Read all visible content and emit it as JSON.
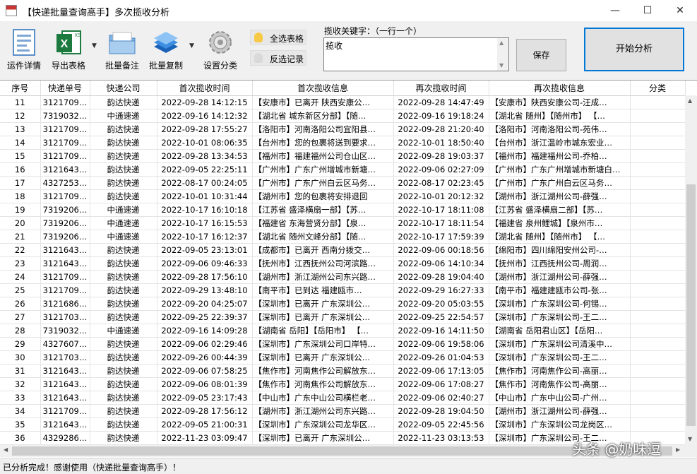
{
  "window": {
    "title": "【快递批量查询高手】多次揽收分析",
    "min": "—",
    "max": "☐",
    "close": "✕"
  },
  "toolbar": {
    "detail": "运件详情",
    "export": "导出表格",
    "export_badge": "XS",
    "remark": "批量备注",
    "copy": "批量复制",
    "category": "设置分类",
    "select_all": "全选表格",
    "invert": "反选记录",
    "keyword_label": "揽收关键字：（一行一个）",
    "keyword_value": "揽收",
    "save": "保存",
    "start": "开始分析"
  },
  "colors": {
    "accent": "#0078d7",
    "excel_green": "#1d7a3e",
    "bulb": "#f7c948"
  },
  "icons": {
    "detail": "document-icon",
    "export": "excel-icon",
    "remark": "folder-icon",
    "copy": "stack-icon",
    "category": "gear-icon",
    "bulb": "bulb-icon"
  },
  "table": {
    "columns": [
      "序号",
      "快递单号",
      "快递公司",
      "首次揽收时间",
      "首次揽收信息",
      "再次揽收时间",
      "再次揽收信息",
      "分类"
    ],
    "rows": [
      [
        "11",
        "3121709…",
        "韵达快递",
        "2022-09-28 14:12:15",
        "【安康市】已离开 陕西安康公…",
        "2022-09-28 14:47:49",
        "【安康市】陕西安康公司-汪成…",
        ""
      ],
      [
        "12",
        "7319032…",
        "中通速递",
        "2022-09-16 14:12:32",
        "【湖北省 城东新区分部】【随…",
        "2022-09-16 19:18:24",
        "【湖北省 随州】【随州市】 【…",
        ""
      ],
      [
        "13",
        "3121709…",
        "韵达快递",
        "2022-09-28 17:55:27",
        "【洛阳市】河南洛阳公司宜阳县…",
        "2022-09-28 21:20:40",
        "【洛阳市】河南洛阳公司-苑伟…",
        ""
      ],
      [
        "14",
        "3121709…",
        "韵达快递",
        "2022-10-01 08:06:35",
        "【台州市】您的包裹将送到要求…",
        "2022-10-01 18:50:40",
        "【台州市】浙江温岭市城东宏业…",
        ""
      ],
      [
        "15",
        "3121709…",
        "韵达快递",
        "2022-09-28 13:34:53",
        "【福州市】福建福州公司仓山区…",
        "2022-09-28 19:03:37",
        "【福州市】福建福州公司-乔柏…",
        ""
      ],
      [
        "16",
        "3121643…",
        "韵达快递",
        "2022-09-05 22:25:11",
        "【广州市】广东广州增城市新塘…",
        "2022-09-06 02:27:09",
        "【广州市】广东广州增城市新塘白…",
        ""
      ],
      [
        "17",
        "4327253…",
        "韵达快递",
        "2022-08-17 00:24:05",
        "【广州市】广东广州白云区马务…",
        "2022-08-17 02:23:45",
        "【广州市】广东广州白云区马务…",
        ""
      ],
      [
        "18",
        "3121709…",
        "韵达快递",
        "2022-10-01 10:31:44",
        "【湖州市】您的包裹将安排退回",
        "2022-10-01 20:12:32",
        "【湖州市】浙江湖州公司-薛强…",
        ""
      ],
      [
        "19",
        "7319206…",
        "中通速递",
        "2022-10-17 16:10:18",
        "【江苏省 盛泽横扇一部】【苏…",
        "2022-10-17 18:11:08",
        "【江苏省 盛泽横扇二部】【苏…",
        ""
      ],
      [
        "20",
        "7319206…",
        "中通速递",
        "2022-10-17 16:15:53",
        "【福建省 东海营贤分部】【泉…",
        "2022-10-17 18:11:54",
        "【福建省 泉州鲤城】【泉州市…",
        ""
      ],
      [
        "21",
        "7319206…",
        "中通速递",
        "2022-10-17 16:12:37",
        "【湖北省 随州文峰分部】【随…",
        "2022-10-17 17:59:39",
        "【湖北省 随州】【随州市】 【…",
        ""
      ],
      [
        "22",
        "3121643…",
        "韵达快递",
        "2022-09-05 23:13:01",
        "【成都市】已离开 西南分拨交…",
        "2022-09-06 00:18:56",
        "【绵阳市】四川绵阳安州公司-…",
        ""
      ],
      [
        "23",
        "3121643…",
        "韵达快递",
        "2022-09-06 09:46:33",
        "【抚州市】江西抚州公司河滨路…",
        "2022-09-06 14:10:34",
        "【抚州市】江西抚州公司-周润…",
        ""
      ],
      [
        "24",
        "3121709…",
        "韵达快递",
        "2022-09-28 17:56:10",
        "【湖州市】浙江湖州公司东兴路…",
        "2022-09-28 19:04:40",
        "【湖州市】浙江湖州公司-薛强…",
        ""
      ],
      [
        "25",
        "3121709…",
        "韵达快递",
        "2022-09-29 13:48:10",
        "【南平市】已到达 福建瓯市…",
        "2022-09-29 16:27:33",
        "【南平市】福建建瓯市公司-张…",
        ""
      ],
      [
        "26",
        "3121686…",
        "韵达快递",
        "2022-09-20 04:25:07",
        "【深圳市】已离开 广东深圳公…",
        "2022-09-20 05:03:55",
        "【深圳市】广东深圳公司-何锡…",
        ""
      ],
      [
        "27",
        "3121703…",
        "韵达快递",
        "2022-09-25 22:39:37",
        "【深圳市】已离开 广东深圳公…",
        "2022-09-25 22:54:57",
        "【深圳市】广东深圳公司-王二…",
        ""
      ],
      [
        "28",
        "7319032…",
        "中通速递",
        "2022-09-16 14:09:28",
        "【湖南省 岳阳】【岳阳市】 【…",
        "2022-09-16 14:11:50",
        "【湖南省 岳阳君山区】【岳阳…",
        ""
      ],
      [
        "29",
        "4327607…",
        "韵达快递",
        "2022-09-06 02:29:46",
        "【深圳市】广东深圳公司口岸特…",
        "2022-09-06 19:58:06",
        "【深圳市】广东深圳公司清溪中…",
        ""
      ],
      [
        "30",
        "3121703…",
        "韵达快递",
        "2022-09-26 00:44:39",
        "【深圳市】已离开 广东深圳公…",
        "2022-09-26 01:04:53",
        "【深圳市】广东深圳公司-王二…",
        ""
      ],
      [
        "31",
        "3121643…",
        "韵达快递",
        "2022-09-06 07:58:25",
        "【焦作市】河南焦作公司解放东…",
        "2022-09-06 17:13:05",
        "【焦作市】河南焦作公司-高丽…",
        ""
      ],
      [
        "32",
        "3121643…",
        "韵达快递",
        "2022-09-06 08:01:39",
        "【焦作市】河南焦作公司解放东…",
        "2022-09-06 17:08:27",
        "【焦作市】河南焦作公司-高丽…",
        ""
      ],
      [
        "33",
        "3121643…",
        "韵达快递",
        "2022-09-05 23:17:43",
        "【中山市】广东中山公司横栏老…",
        "2022-09-06 02:40:27",
        "【中山市】广东中山公司-广州…",
        ""
      ],
      [
        "34",
        "3121709…",
        "韵达快递",
        "2022-09-28 17:56:12",
        "【湖州市】浙江湖州公司东兴路…",
        "2022-09-28 19:04:50",
        "【湖州市】浙江湖州公司-薛强…",
        ""
      ],
      [
        "35",
        "3121643…",
        "韵达快递",
        "2022-09-05 21:00:31",
        "【深圳市】广东深圳公司龙华区…",
        "2022-09-05 22:45:56",
        "【深圳市】广东深圳公司龙岗区…",
        ""
      ],
      [
        "36",
        "4329286…",
        "韵达快递",
        "2022-11-23 03:09:47",
        "【深圳市】已离开 广东深圳公…",
        "2022-11-23 03:13:53",
        "【深圳市】广东深圳公司-王二…",
        ""
      ]
    ]
  },
  "status": "已分析完成！感谢使用（快递批量查询高手）！",
  "watermark": "头条 @奶味逗"
}
